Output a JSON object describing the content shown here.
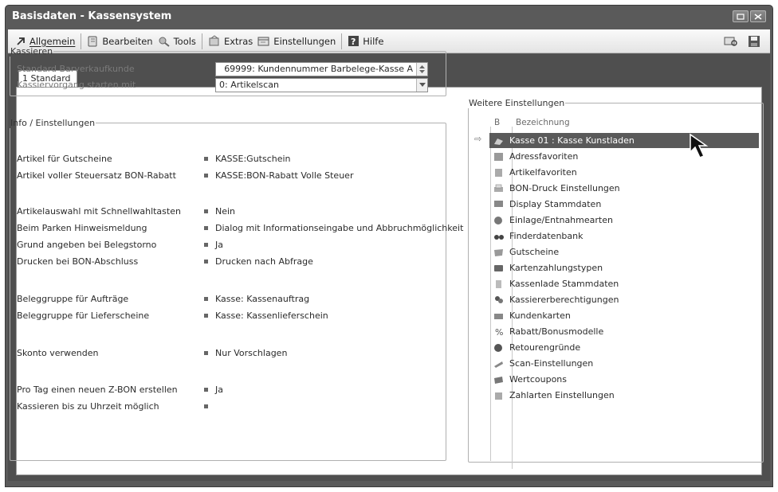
{
  "window": {
    "title": "Basisdaten - Kassensystem"
  },
  "toolbar": {
    "items": [
      {
        "label": "Allgemein",
        "icon": "arrow-icon"
      },
      {
        "label": "Bearbeiten",
        "icon": "edit-icon"
      },
      {
        "label": "Tools",
        "icon": "tools-icon"
      },
      {
        "label": "Extras",
        "icon": "extras-icon"
      },
      {
        "label": "Einstellungen",
        "icon": "settings-icon"
      },
      {
        "label": "Hilfe",
        "icon": "help-icon"
      }
    ]
  },
  "tabs": [
    {
      "label": "1 Standard"
    }
  ],
  "kassieren": {
    "legend": "Kassieren",
    "standard_kunde_label": "Standard Barverkaufkunde",
    "standard_kunde_value": "69999: Kundennummer Barbelege-Kasse A",
    "vorgang_label": "Kassiervorgang starten mit",
    "vorgang_value": "0: Artikelscan"
  },
  "info": {
    "legend": "Info / Einstellungen",
    "rows": [
      {
        "label": "Artikel für Gutscheine",
        "value": "KASSE:Gutschein"
      },
      {
        "label": "Artikel voller Steuersatz BON-Rabatt",
        "value": "KASSE:BON-Rabatt Volle Steuer"
      },
      {
        "label": "Artikelauswahl mit Schnellwahltasten",
        "value": "Nein"
      },
      {
        "label": "Beim Parken Hinweismeldung",
        "value": "Dialog mit Informationseingabe und Abbruchmöglichkeit"
      },
      {
        "label": "Grund angeben bei Belegstorno",
        "value": "Ja"
      },
      {
        "label": "Drucken bei BON-Abschluss",
        "value": "Drucken nach Abfrage"
      },
      {
        "label": "Beleggruppe für Aufträge",
        "value": "Kasse: Kassenauftrag"
      },
      {
        "label": "Beleggruppe für Lieferscheine",
        "value": "Kasse: Kassenlieferschein"
      },
      {
        "label": "Skonto verwenden",
        "value": "Nur Vorschlagen"
      },
      {
        "label": "Pro Tag einen neuen Z-BON erstellen",
        "value": "Ja"
      },
      {
        "label": "Kassieren bis zu Uhrzeit möglich",
        "value": ""
      }
    ]
  },
  "weitere": {
    "legend": "Weitere Einstellungen",
    "col_b": "B",
    "col_bez": "Bezeichnung",
    "items": [
      {
        "label": "Kasse 01 : Kasse Kunstladen",
        "icon": "register-icon",
        "selected": true
      },
      {
        "label": "Adressfavoriten",
        "icon": "address-icon"
      },
      {
        "label": "Artikelfavoriten",
        "icon": "article-icon"
      },
      {
        "label": "BON-Druck Einstellungen",
        "icon": "printer-icon"
      },
      {
        "label": "Display Stammdaten",
        "icon": "display-icon"
      },
      {
        "label": "Einlage/Entnahmearten",
        "icon": "money-icon"
      },
      {
        "label": "Finderdatenbank",
        "icon": "binoculars-icon"
      },
      {
        "label": "Gutscheine",
        "icon": "voucher-icon"
      },
      {
        "label": "Kartenzahlungstypen",
        "icon": "card-icon"
      },
      {
        "label": "Kassenlade Stammdaten",
        "icon": "drawer-icon"
      },
      {
        "label": "Kassiererberechtigungen",
        "icon": "users-icon"
      },
      {
        "label": "Kundenkarten",
        "icon": "customer-card-icon"
      },
      {
        "label": "Rabatt/Bonusmodelle",
        "icon": "percent-icon"
      },
      {
        "label": "Retourengründe",
        "icon": "return-icon"
      },
      {
        "label": "Scan-Einstellungen",
        "icon": "scanner-icon"
      },
      {
        "label": "Wertcoupons",
        "icon": "coupon-icon"
      },
      {
        "label": "Zahlarten Einstellungen",
        "icon": "payment-icon"
      }
    ]
  }
}
